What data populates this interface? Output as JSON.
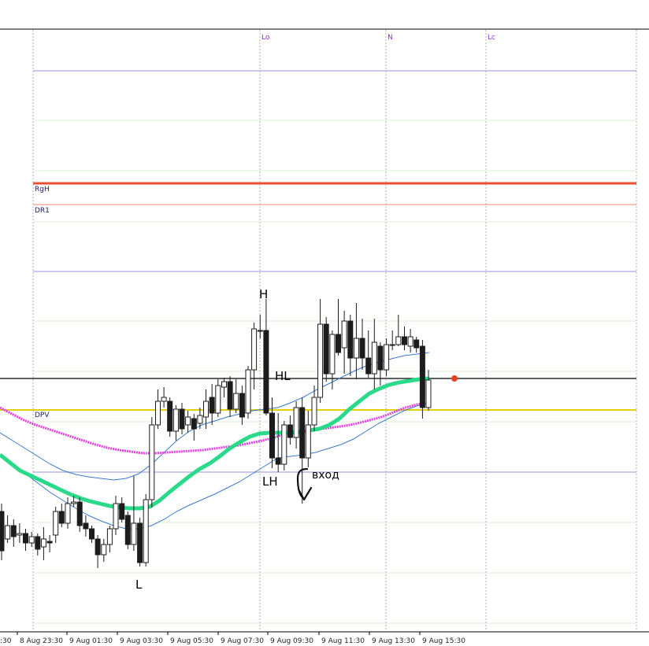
{
  "chart_data": {
    "type": "candlestick",
    "x_tick_labels": [
      "8 Aug 23:30",
      "9 Aug 01:30",
      "9 Aug 03:30",
      "9 Aug 05:30",
      "9 Aug 07:30",
      "9 Aug 09:30",
      "9 Aug 11:30",
      "9 Aug 13:30",
      "9 Aug 15:30"
    ],
    "edge_tick_label": ":30",
    "session_labels": [
      {
        "text": "Lo",
        "at": "9 Aug 07:30"
      },
      {
        "text": "N",
        "at": "9 Aug 13:30"
      },
      {
        "text": "Lc",
        "at": "9 Aug 17:30"
      }
    ],
    "levels": [
      {
        "name": "RgH",
        "color": "#f05030"
      },
      {
        "name": "DR1",
        "color": "#f08070"
      },
      {
        "name": "DPV",
        "color": "#e0d000"
      }
    ],
    "annotations": [
      {
        "text": "H"
      },
      {
        "text": "HL"
      },
      {
        "text": "LH"
      },
      {
        "text": "L"
      },
      {
        "text": "вход"
      }
    ],
    "colors": {
      "bull_candle": "#ffffff",
      "bear_candle": "#1c1c1c",
      "ma_fast": "#2bd98a",
      "ma_slow": "#e040e0",
      "bands": "#3a78d0",
      "current_price_line": "#000000",
      "marker": "#e8401c"
    },
    "candles": [
      [
        650,
        700,
        640,
        712
      ],
      [
        685,
        668,
        655,
        690
      ],
      [
        668,
        682,
        660,
        695
      ],
      [
        680,
        678,
        665,
        690
      ],
      [
        678,
        690,
        672,
        700
      ],
      [
        690,
        682,
        676,
        695
      ],
      [
        682,
        698,
        678,
        706
      ],
      [
        695,
        685,
        670,
        712
      ],
      [
        688,
        690,
        680,
        702
      ],
      [
        680,
        650,
        644,
        690
      ],
      [
        650,
        665,
        640,
        670
      ],
      [
        665,
        640,
        632,
        672
      ],
      [
        640,
        638,
        630,
        644
      ],
      [
        638,
        668,
        632,
        676
      ],
      [
        665,
        672,
        655,
        682
      ],
      [
        672,
        685,
        668,
        690
      ],
      [
        685,
        705,
        680,
        722
      ],
      [
        705,
        692,
        685,
        714
      ],
      [
        692,
        672,
        668,
        702
      ],
      [
        672,
        640,
        630,
        680
      ],
      [
        640,
        660,
        632,
        664
      ],
      [
        655,
        692,
        650,
        698
      ],
      [
        692,
        665,
        605,
        700
      ],
      [
        665,
        715,
        658,
        720
      ],
      [
        715,
        635,
        628,
        720
      ],
      [
        635,
        540,
        530,
        645
      ],
      [
        540,
        510,
        495,
        545
      ],
      [
        510,
        505,
        492,
        518
      ],
      [
        510,
        548,
        505,
        555
      ],
      [
        548,
        520,
        515,
        560
      ],
      [
        520,
        545,
        512,
        552
      ],
      [
        540,
        530,
        522,
        550
      ],
      [
        532,
        545,
        526,
        560
      ],
      [
        538,
        528,
        518,
        545
      ],
      [
        530,
        510,
        495,
        545
      ],
      [
        505,
        525,
        488,
        540
      ],
      [
        525,
        490,
        482,
        530
      ],
      [
        492,
        485,
        480,
        505
      ],
      [
        485,
        520,
        478,
        530
      ],
      [
        520,
        500,
        482,
        525
      ],
      [
        500,
        530,
        490,
        540
      ],
      [
        525,
        470,
        465,
        532
      ],
      [
        470,
        418,
        410,
        495
      ],
      [
        420,
        420,
        400,
        430
      ],
      [
        420,
        525,
        380,
        528
      ],
      [
        525,
        582,
        505,
        595
      ],
      [
        582,
        590,
        525,
        600
      ],
      [
        590,
        540,
        535,
        598
      ],
      [
        540,
        556,
        528,
        565
      ],
      [
        556,
        518,
        510,
        570
      ],
      [
        518,
        582,
        505,
        640
      ],
      [
        582,
        540,
        522,
        594
      ],
      [
        540,
        505,
        490,
        548
      ],
      [
        505,
        412,
        380,
        512
      ],
      [
        412,
        475,
        403,
        485
      ],
      [
        475,
        425,
        420,
        495
      ],
      [
        425,
        448,
        380,
        452
      ],
      [
        442,
        408,
        395,
        475
      ],
      [
        408,
        455,
        400,
        478
      ],
      [
        455,
        430,
        385,
        482
      ],
      [
        430,
        455,
        405,
        470
      ],
      [
        455,
        475,
        420,
        480
      ],
      [
        475,
        435,
        405,
        495
      ],
      [
        440,
        470,
        435,
        490
      ],
      [
        470,
        438,
        430,
        478
      ],
      [
        438,
        438,
        420,
        445
      ],
      [
        438,
        428,
        400,
        440
      ],
      [
        428,
        438,
        415,
        445
      ],
      [
        440,
        428,
        418,
        448
      ],
      [
        432,
        442,
        428,
        448
      ],
      [
        440,
        518,
        432,
        532
      ],
      [
        518,
        483,
        470,
        522
      ]
    ],
    "ma_fast": [
      578,
      588,
      598,
      604,
      610,
      616,
      622,
      628,
      633,
      637,
      640,
      643,
      645,
      646,
      646,
      644,
      636,
      625,
      615,
      605,
      596,
      589,
      580,
      570,
      562,
      555,
      551,
      550,
      550,
      550,
      549,
      547,
      545,
      540,
      532,
      520,
      510,
      500,
      494,
      489,
      486,
      484,
      482,
      481
    ],
    "ma_slow": [
      518,
      526,
      534,
      540,
      545,
      550,
      555,
      560,
      565,
      569,
      572,
      574,
      576,
      576,
      575,
      574,
      573,
      572,
      570,
      568,
      566,
      563,
      560,
      556,
      551,
      548,
      546,
      545,
      543,
      541,
      538,
      534,
      530,
      524,
      518,
      514,
      512
    ],
    "band_upper": [
      550,
      560,
      570,
      580,
      590,
      598,
      603,
      606,
      608,
      610,
      608,
      602,
      590,
      575,
      560,
      548,
      540,
      535,
      530,
      526,
      522,
      520,
      518,
      512,
      505,
      496,
      488,
      480,
      472,
      465,
      460,
      456,
      452,
      450,
      448
    ],
    "band_lower": [
      578,
      590,
      602,
      614,
      626,
      636,
      646,
      655,
      662,
      668,
      672,
      672,
      668,
      660,
      650,
      642,
      635,
      628,
      620,
      612,
      602,
      592,
      582,
      580,
      578,
      575,
      570,
      565,
      558,
      548,
      538,
      530,
      522,
      516,
      512
    ]
  }
}
